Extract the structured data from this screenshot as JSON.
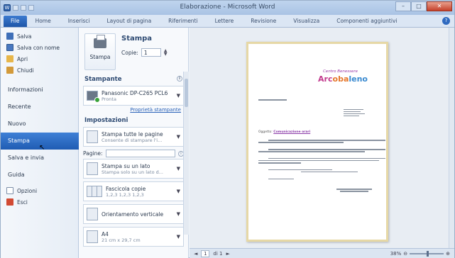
{
  "window": {
    "title": "Elaborazione - Microsoft Word",
    "minimize": "–",
    "maximize": "□",
    "close": "✕",
    "help": "?"
  },
  "ribbon_tabs": [
    "File",
    "Home",
    "Inserisci",
    "Layout di pagina",
    "Riferimenti",
    "Lettere",
    "Revisione",
    "Visualizza",
    "Componenti aggiuntivi"
  ],
  "sidebar": {
    "commands": [
      {
        "label": "Salva",
        "icon": "save-icon"
      },
      {
        "label": "Salva con nome",
        "icon": "save-as-icon"
      },
      {
        "label": "Apri",
        "icon": "open-folder-icon"
      },
      {
        "label": "Chiudi",
        "icon": "close-folder-icon"
      }
    ],
    "nav": [
      "Informazioni",
      "Recente",
      "Nuovo",
      "Stampa",
      "Salva e invia",
      "Guida"
    ],
    "selected": "Stampa",
    "options_label": "Opzioni",
    "exit_label": "Esci"
  },
  "print": {
    "title": "Stampa",
    "button_label": "Stampa",
    "copies_label": "Copie:",
    "copies_value": "1",
    "printer_heading": "Stampante",
    "printer_name": "Panasonic DP-C265 PCL6",
    "printer_status": "Pronta",
    "printer_props": "Proprietà stampante",
    "settings_heading": "Impostazioni",
    "pages_label": "Pagine:",
    "settings": [
      {
        "t1": "Stampa tutte le pagine",
        "t2": "Consente di stampare l'i..."
      },
      {
        "t1": "Stampa su un lato",
        "t2": "Stampa solo su un lato d..."
      },
      {
        "t1": "Fascicola copie",
        "t2": "1,2,3   1,2,3   1,2,3"
      },
      {
        "t1": "Orientamento verticale",
        "t2": ""
      },
      {
        "t1": "A4",
        "t2": "21 cm x 29,7 cm"
      }
    ]
  },
  "preview": {
    "logo_sub": "Centro Benessere",
    "logo_parts": [
      "Arc",
      "oba",
      "leno"
    ],
    "subject_label": "Oggetto:",
    "subject_text": "Comunicazione orari"
  },
  "status": {
    "page_current": "1",
    "page_total": "di 1",
    "prev": "◄",
    "next": "►",
    "zoom": "38%",
    "zoom_out": "⊖",
    "zoom_in": "⊕"
  }
}
